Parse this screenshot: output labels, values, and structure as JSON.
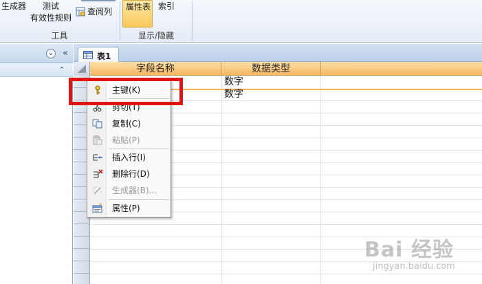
{
  "ribbon": {
    "tools_group": {
      "label": "工具",
      "items": [
        "生成器",
        "测试",
        "有效性规则"
      ],
      "lookup_label": "查阅列"
    },
    "show_hide_group": {
      "label": "显示/隐藏",
      "property_sheet": "属性表",
      "indexes": "索引"
    }
  },
  "nav": {
    "dropdown_glyph": "⌄",
    "collapse_glyph": "«",
    "expand_glyph": "⌃"
  },
  "tab": {
    "title": "表1"
  },
  "grid": {
    "columns": [
      "字段名称",
      "数据类型"
    ],
    "rows": [
      {
        "type": "数字"
      },
      {
        "type": "数字"
      }
    ]
  },
  "context_menu": {
    "items": [
      {
        "label": "主键(K)",
        "icon": "key-icon",
        "disabled": false
      },
      {
        "label": "剪切(T)",
        "icon": "scissors-icon",
        "disabled": false
      },
      {
        "label": "复制(C)",
        "icon": "copy-icon",
        "disabled": false
      },
      {
        "label": "粘贴(P)",
        "icon": "paste-icon",
        "disabled": true
      },
      {
        "label": "插入行(I)",
        "icon": "insert-row-icon",
        "disabled": false
      },
      {
        "label": "删除行(D)",
        "icon": "delete-row-icon",
        "disabled": false
      },
      {
        "label": "生成器(B)...",
        "icon": "builder-wand-icon",
        "disabled": true
      },
      {
        "label": "属性(P)",
        "icon": "properties-icon",
        "disabled": false
      }
    ]
  },
  "colors": {
    "annotation": "#e01515",
    "header_orange": "#f6b662",
    "ribbon_blue": "#e3ebf5"
  },
  "watermark": {
    "logo": "Bai 经验",
    "url": "jingyan.baidu.com"
  }
}
